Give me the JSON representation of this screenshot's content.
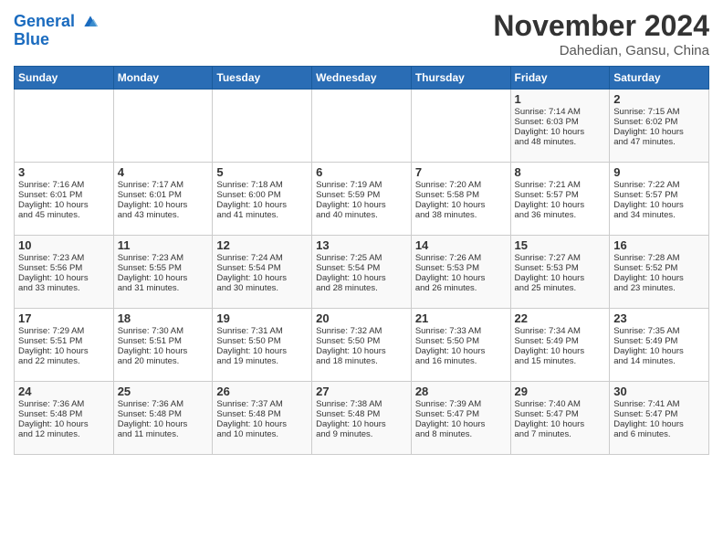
{
  "header": {
    "logo_line1": "General",
    "logo_line2": "Blue",
    "month": "November 2024",
    "location": "Dahedian, Gansu, China"
  },
  "weekdays": [
    "Sunday",
    "Monday",
    "Tuesday",
    "Wednesday",
    "Thursday",
    "Friday",
    "Saturday"
  ],
  "weeks": [
    [
      {
        "day": "",
        "info": ""
      },
      {
        "day": "",
        "info": ""
      },
      {
        "day": "",
        "info": ""
      },
      {
        "day": "",
        "info": ""
      },
      {
        "day": "",
        "info": ""
      },
      {
        "day": "1",
        "info": "Sunrise: 7:14 AM\nSunset: 6:03 PM\nDaylight: 10 hours\nand 48 minutes."
      },
      {
        "day": "2",
        "info": "Sunrise: 7:15 AM\nSunset: 6:02 PM\nDaylight: 10 hours\nand 47 minutes."
      }
    ],
    [
      {
        "day": "3",
        "info": "Sunrise: 7:16 AM\nSunset: 6:01 PM\nDaylight: 10 hours\nand 45 minutes."
      },
      {
        "day": "4",
        "info": "Sunrise: 7:17 AM\nSunset: 6:01 PM\nDaylight: 10 hours\nand 43 minutes."
      },
      {
        "day": "5",
        "info": "Sunrise: 7:18 AM\nSunset: 6:00 PM\nDaylight: 10 hours\nand 41 minutes."
      },
      {
        "day": "6",
        "info": "Sunrise: 7:19 AM\nSunset: 5:59 PM\nDaylight: 10 hours\nand 40 minutes."
      },
      {
        "day": "7",
        "info": "Sunrise: 7:20 AM\nSunset: 5:58 PM\nDaylight: 10 hours\nand 38 minutes."
      },
      {
        "day": "8",
        "info": "Sunrise: 7:21 AM\nSunset: 5:57 PM\nDaylight: 10 hours\nand 36 minutes."
      },
      {
        "day": "9",
        "info": "Sunrise: 7:22 AM\nSunset: 5:57 PM\nDaylight: 10 hours\nand 34 minutes."
      }
    ],
    [
      {
        "day": "10",
        "info": "Sunrise: 7:23 AM\nSunset: 5:56 PM\nDaylight: 10 hours\nand 33 minutes."
      },
      {
        "day": "11",
        "info": "Sunrise: 7:23 AM\nSunset: 5:55 PM\nDaylight: 10 hours\nand 31 minutes."
      },
      {
        "day": "12",
        "info": "Sunrise: 7:24 AM\nSunset: 5:54 PM\nDaylight: 10 hours\nand 30 minutes."
      },
      {
        "day": "13",
        "info": "Sunrise: 7:25 AM\nSunset: 5:54 PM\nDaylight: 10 hours\nand 28 minutes."
      },
      {
        "day": "14",
        "info": "Sunrise: 7:26 AM\nSunset: 5:53 PM\nDaylight: 10 hours\nand 26 minutes."
      },
      {
        "day": "15",
        "info": "Sunrise: 7:27 AM\nSunset: 5:53 PM\nDaylight: 10 hours\nand 25 minutes."
      },
      {
        "day": "16",
        "info": "Sunrise: 7:28 AM\nSunset: 5:52 PM\nDaylight: 10 hours\nand 23 minutes."
      }
    ],
    [
      {
        "day": "17",
        "info": "Sunrise: 7:29 AM\nSunset: 5:51 PM\nDaylight: 10 hours\nand 22 minutes."
      },
      {
        "day": "18",
        "info": "Sunrise: 7:30 AM\nSunset: 5:51 PM\nDaylight: 10 hours\nand 20 minutes."
      },
      {
        "day": "19",
        "info": "Sunrise: 7:31 AM\nSunset: 5:50 PM\nDaylight: 10 hours\nand 19 minutes."
      },
      {
        "day": "20",
        "info": "Sunrise: 7:32 AM\nSunset: 5:50 PM\nDaylight: 10 hours\nand 18 minutes."
      },
      {
        "day": "21",
        "info": "Sunrise: 7:33 AM\nSunset: 5:50 PM\nDaylight: 10 hours\nand 16 minutes."
      },
      {
        "day": "22",
        "info": "Sunrise: 7:34 AM\nSunset: 5:49 PM\nDaylight: 10 hours\nand 15 minutes."
      },
      {
        "day": "23",
        "info": "Sunrise: 7:35 AM\nSunset: 5:49 PM\nDaylight: 10 hours\nand 14 minutes."
      }
    ],
    [
      {
        "day": "24",
        "info": "Sunrise: 7:36 AM\nSunset: 5:48 PM\nDaylight: 10 hours\nand 12 minutes."
      },
      {
        "day": "25",
        "info": "Sunrise: 7:36 AM\nSunset: 5:48 PM\nDaylight: 10 hours\nand 11 minutes."
      },
      {
        "day": "26",
        "info": "Sunrise: 7:37 AM\nSunset: 5:48 PM\nDaylight: 10 hours\nand 10 minutes."
      },
      {
        "day": "27",
        "info": "Sunrise: 7:38 AM\nSunset: 5:48 PM\nDaylight: 10 hours\nand 9 minutes."
      },
      {
        "day": "28",
        "info": "Sunrise: 7:39 AM\nSunset: 5:47 PM\nDaylight: 10 hours\nand 8 minutes."
      },
      {
        "day": "29",
        "info": "Sunrise: 7:40 AM\nSunset: 5:47 PM\nDaylight: 10 hours\nand 7 minutes."
      },
      {
        "day": "30",
        "info": "Sunrise: 7:41 AM\nSunset: 5:47 PM\nDaylight: 10 hours\nand 6 minutes."
      }
    ]
  ]
}
